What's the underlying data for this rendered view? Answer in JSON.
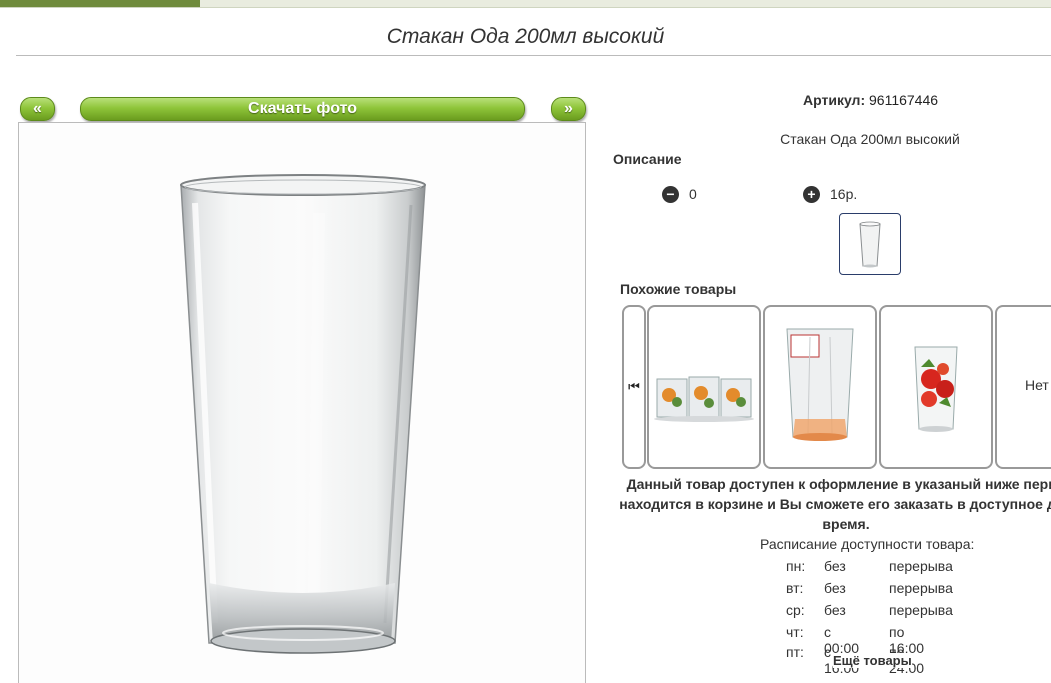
{
  "page_title": "Стакан Ода 200мл высокий",
  "photo_nav": {
    "prev_label": "«",
    "download_label": "Скачать фото",
    "next_label": "»"
  },
  "product": {
    "article_label": "Артикул:",
    "article_value": "961167446",
    "description_text": "Стакан Ода 200мл высокий",
    "description_heading": "Описание",
    "votes": {
      "minus_value": "0",
      "plus_value": "16р."
    }
  },
  "similar": {
    "heading": "Похожие товары",
    "cards": [
      {
        "icon": "glass-set-product-image"
      },
      {
        "icon": "faceted-orange-glass-product-image"
      },
      {
        "icon": "strawberry-glass-product-image"
      },
      {
        "text": "Нет"
      }
    ]
  },
  "availability": {
    "notice_line1": "Данный товар доступен к оформление в указаный ниже перио",
    "notice_line2": "находится в корзине и Вы сможете его заказать в доступное для",
    "notice_line3": "время.",
    "schedule_heading": "Расписание доступности товара:",
    "schedule": [
      {
        "day": "пн:",
        "from": "без",
        "to": "перерыва"
      },
      {
        "day": "вт:",
        "from": "без",
        "to": "перерыва"
      },
      {
        "day": "ср:",
        "from": "без",
        "to": "перерыва"
      },
      {
        "day": "чт:",
        "from": "с 00:00",
        "to": "по 16:00"
      },
      {
        "day": "пт:",
        "from": "с 16:00",
        "to": "по 24:00"
      }
    ],
    "more_label": "Ещё товары"
  },
  "colors": {
    "accent_green": "#8fc53a",
    "thumb_border": "#2a3d6a"
  }
}
